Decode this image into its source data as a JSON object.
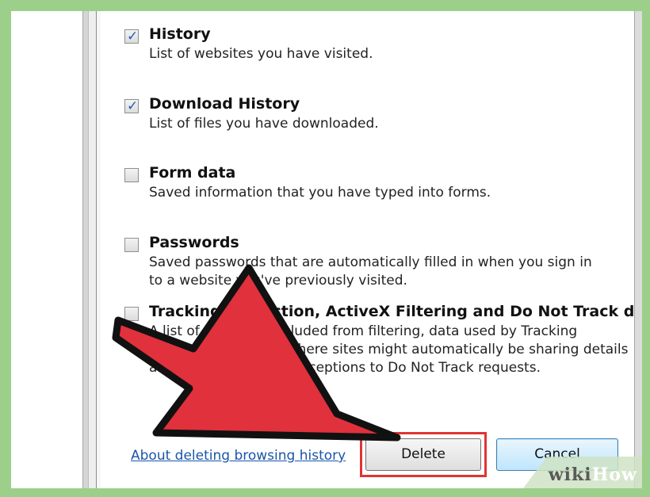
{
  "options": [
    {
      "title": "History",
      "desc": [
        "List of websites you have visited."
      ],
      "checked": true
    },
    {
      "title": "Download History",
      "desc": [
        "List of files you have downloaded."
      ],
      "checked": true
    },
    {
      "title": "Form data",
      "desc": [
        "Saved information that you have typed into forms."
      ],
      "checked": false
    },
    {
      "title": "Passwords",
      "desc": [
        "Saved passwords that are automatically filled in when you sign in",
        "to a website you've previously visited."
      ],
      "checked": false
    },
    {
      "title": "Tracking Protection, ActiveX Filtering and Do Not Track d",
      "desc": [
        "A list of websites excluded from filtering, data used by Tracking",
        "Protection to detect where sites might automatically be sharing details",
        "about your visit, and exceptions to Do Not Track requests."
      ],
      "checked": false
    }
  ],
  "footer": {
    "about_link": "About deleting browsing history",
    "delete_label": "Delete",
    "cancel_label": "Cancel"
  },
  "checkmark_glyph": "✓",
  "watermark": {
    "wiki": "wiki",
    "how": "How"
  },
  "colors": {
    "background": "#9ccf8a",
    "highlight": "#e03434",
    "arrow_fill": "#e0313c",
    "link": "#1a55a8"
  }
}
